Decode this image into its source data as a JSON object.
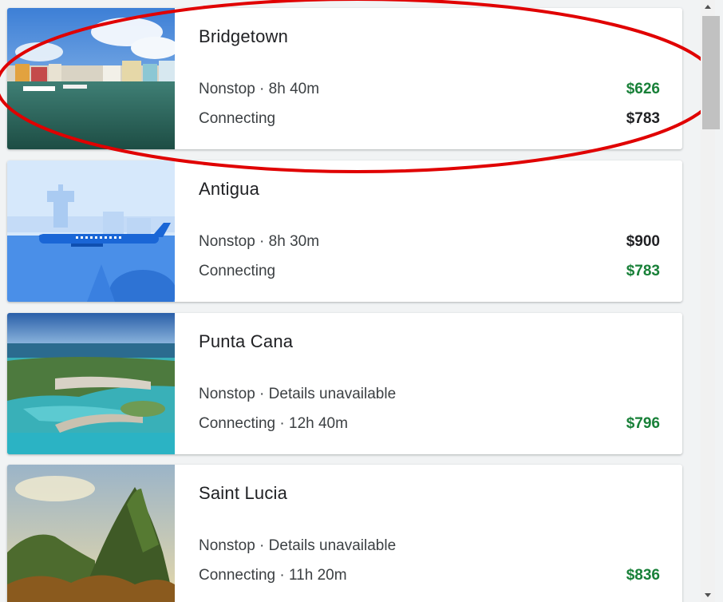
{
  "destinations": [
    {
      "name": "Bridgetown",
      "image": "bridgetown-harbor-photo",
      "rows": [
        {
          "label": "Nonstop · 8h 40m",
          "price": "$626",
          "price_color": "#188038"
        },
        {
          "label": "Connecting",
          "price": "$783",
          "price_color": "#202124"
        }
      ]
    },
    {
      "name": "Antigua",
      "image": "airplane-illustration",
      "rows": [
        {
          "label": "Nonstop · 8h 30m",
          "price": "$900",
          "price_color": "#202124"
        },
        {
          "label": "Connecting",
          "price": "$783",
          "price_color": "#188038"
        }
      ]
    },
    {
      "name": "Punta Cana",
      "image": "punta-cana-marina-photo",
      "rows": [
        {
          "label": "Nonstop · Details unavailable",
          "price": "",
          "price_color": "#202124"
        },
        {
          "label": "Connecting · 12h 40m",
          "price": "$796",
          "price_color": "#188038"
        }
      ]
    },
    {
      "name": "Saint Lucia",
      "image": "saint-lucia-pitons-photo",
      "rows": [
        {
          "label": "Nonstop · Details unavailable",
          "price": "",
          "price_color": "#202124"
        },
        {
          "label": "Connecting · 11h 20m",
          "price": "$836",
          "price_color": "#188038"
        }
      ]
    }
  ],
  "colors": {
    "cheap_price": "#188038",
    "normal_price": "#202124",
    "highlight_ellipse": "#e00000"
  }
}
